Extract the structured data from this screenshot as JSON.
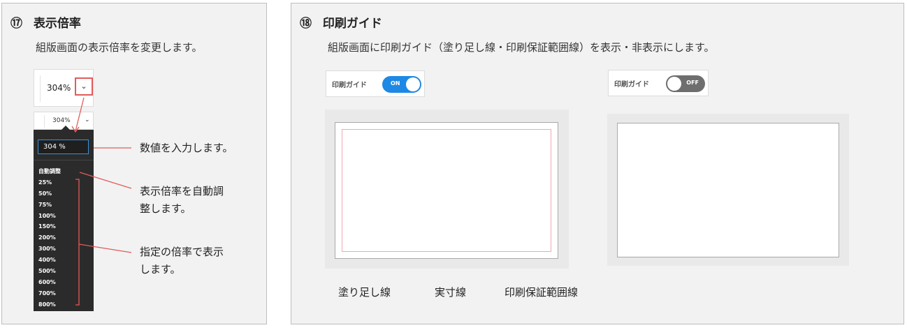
{
  "section17": {
    "number": "⑰",
    "title": "表示倍率",
    "description": "組版画面の表示倍率を変更します。",
    "zoom_value": "304%",
    "zoom_caret": "⌄",
    "mini_zoom_value": "304%",
    "input_value": "304 %",
    "options": [
      "自動調整",
      "25%",
      "50%",
      "75%",
      "100%",
      "150%",
      "200%",
      "300%",
      "400%",
      "500%",
      "600%",
      "700%",
      "800%"
    ],
    "callout_input": "数値を入力します。",
    "callout_auto_line1": "表示倍率を自動調",
    "callout_auto_line2": "整します。",
    "callout_preset_line1": "指定の倍率で表示",
    "callout_preset_line2": "します。"
  },
  "section18": {
    "number": "⑱",
    "title": "印刷ガイド",
    "description": "組版画面に印刷ガイド（塗り足し線・印刷保証範囲線）を表示・非表示にします。",
    "toggle_label": "印刷ガイド",
    "on_text": "ON",
    "off_text": "OFF",
    "labels": {
      "bleed": "塗り足し線",
      "trim": "実寸線",
      "safe": "印刷保証範囲線"
    }
  },
  "colors": {
    "callout_line": "#e25b5b",
    "switch_on": "#1e88e5",
    "switch_off": "#6e6e6e",
    "safe_line": "#f4a6b4",
    "dropdown_bg": "#2b2b2b"
  },
  "icons": {
    "zoom_toggle": "chevron-down-icon",
    "switch_knob": "toggle-knob-icon"
  }
}
